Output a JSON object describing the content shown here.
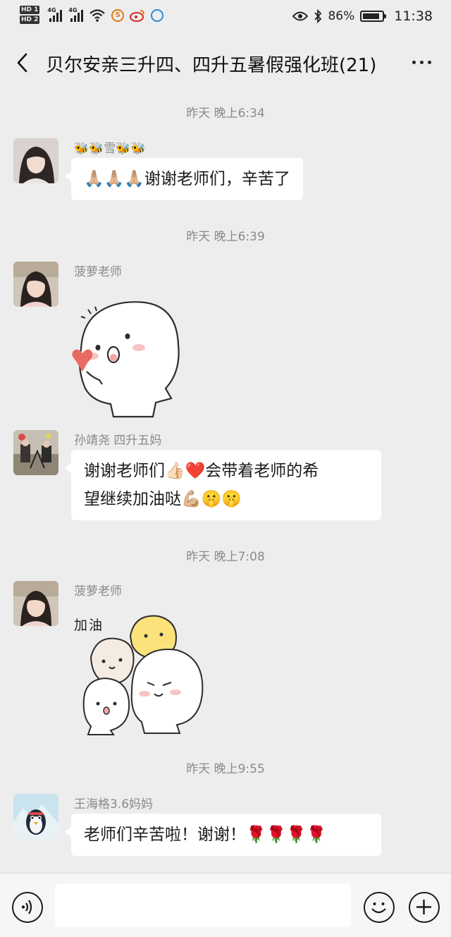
{
  "status_bar": {
    "hd1": "HD 1",
    "hd2": "HD 2",
    "net1": "4G",
    "net2": "4G",
    "battery_percent": "86%",
    "battery_level": 0.86,
    "clock": "11:38",
    "icons": [
      "wifi-icon",
      "app-s-icon",
      "weibo-icon",
      "app-circle-icon",
      "eye-icon",
      "bluetooth-icon",
      "battery-icon"
    ]
  },
  "header": {
    "title": "贝尔安亲三升四、四升五暑假强化班(21)",
    "icons": [
      "back-icon",
      "more-icon"
    ]
  },
  "messages": [
    {
      "type": "time",
      "text": "昨天 晚上6:34"
    },
    {
      "type": "text",
      "sender": "🐝🐝雪🐝🐝",
      "text": "🙏🏼🙏🏼🙏🏼谢谢老师们，辛苦了"
    },
    {
      "type": "time",
      "text": "昨天 晚上6:39"
    },
    {
      "type": "sticker",
      "sender": "菠萝老师"
    },
    {
      "type": "text",
      "sender": "孙靖尧 四升五妈",
      "lines": [
        "谢谢老师们👍🏻❤️会带着老师的希",
        "望继续加油哒💪🏼🤫🤫"
      ]
    },
    {
      "type": "time",
      "text": "昨天 晚上7:08"
    },
    {
      "type": "sticker",
      "sender": "菠萝老师",
      "caption": "加油"
    },
    {
      "type": "time",
      "text": "昨天 晚上9:55"
    },
    {
      "type": "text",
      "sender": "王海格3.6妈妈",
      "text": "老师们辛苦啦！谢谢！🌹🌹🌹🌹"
    }
  ],
  "input_bar": {
    "icons": [
      "voice-icon",
      "emoji-icon",
      "plus-icon"
    ]
  },
  "colors": {
    "background": "#ededed",
    "bubble": "#ffffff",
    "time_text": "#8a8a8a",
    "sender_text": "#8a8a8a"
  }
}
